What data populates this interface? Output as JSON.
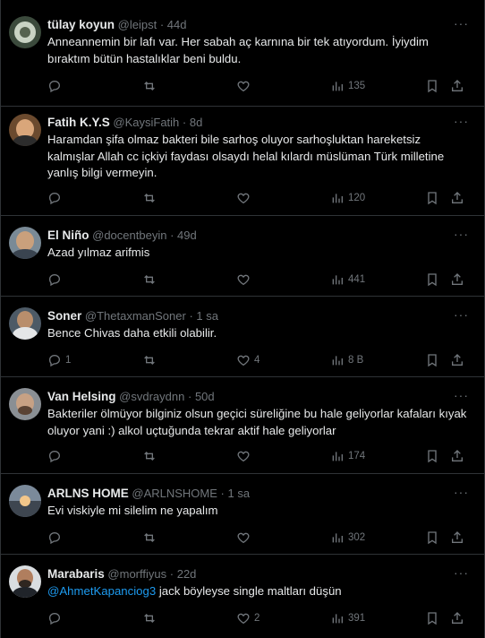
{
  "icons": {
    "reply": "reply-icon",
    "retweet": "retweet-icon",
    "like": "heart-icon",
    "views": "views-bar-chart-icon",
    "bookmark": "bookmark-icon",
    "share": "share-icon",
    "more": "more-options-icon"
  },
  "colors": {
    "background": "#000000",
    "text": "#e7e9ea",
    "muted": "#71767b",
    "link": "#1d9bf0",
    "border": "#2f3336"
  },
  "tweets": [
    {
      "name": "tülay koyun",
      "handle": "@leipst",
      "dot": "·",
      "time": "44d",
      "text": "Anneannemin bir lafı var. Her sabah aç karnına bir tek atıyordum. İyiydim bıraktım bütün hastalıklar beni buldu.",
      "replies": "",
      "retweets": "",
      "likes": "",
      "views": "135"
    },
    {
      "name": "Fatih K.Y.S",
      "handle": "@KaysiFatih",
      "dot": "·",
      "time": "8d",
      "text": "Haramdan şifa olmaz bakteri bile sarhoş oluyor  sarhoşluktan hareketsiz kalmışlar Allah cc içkiyi faydası  olsaydı helal kılardı müslüman Türk milletine yanlış bilgi vermeyin.",
      "replies": "",
      "retweets": "",
      "likes": "",
      "views": "120"
    },
    {
      "name": "El Niño",
      "handle": "@docentbeyin",
      "dot": "·",
      "time": "49d",
      "text": "Azad yılmaz arifmis",
      "replies": "",
      "retweets": "",
      "likes": "",
      "views": "441"
    },
    {
      "name": "Soner",
      "handle": "@ThetaxmanSoner",
      "dot": "·",
      "time": "1 sa",
      "text": "Bence Chivas daha etkili olabilir.",
      "replies": "1",
      "retweets": "",
      "likes": "4",
      "views": "8 B"
    },
    {
      "name": "Van Helsing",
      "handle": "@svdraydnn",
      "dot": "·",
      "time": "50d",
      "text": "Bakteriler ölmüyor bilginiz olsun geçici süreliğine bu hale geliyorlar kafaları kıyak oluyor yani :) alkol uçtuğunda tekrar aktif hale geliyorlar",
      "replies": "",
      "retweets": "",
      "likes": "",
      "views": "174"
    },
    {
      "name": "ARLNS HOME",
      "handle": "@ARLNSHOME",
      "dot": "·",
      "time": "1 sa",
      "text": "Evi viskiyle mi silelim ne yapalım",
      "replies": "",
      "retweets": "",
      "likes": "",
      "views": "302"
    },
    {
      "name": "Marabaris",
      "handle": "@morffiyus",
      "dot": "·",
      "time": "22d",
      "mention": "@AhmetKapanciog3",
      "text": " jack böyleyse single maltları düşün",
      "replies": "",
      "retweets": "",
      "likes": "2",
      "views": "391"
    }
  ]
}
